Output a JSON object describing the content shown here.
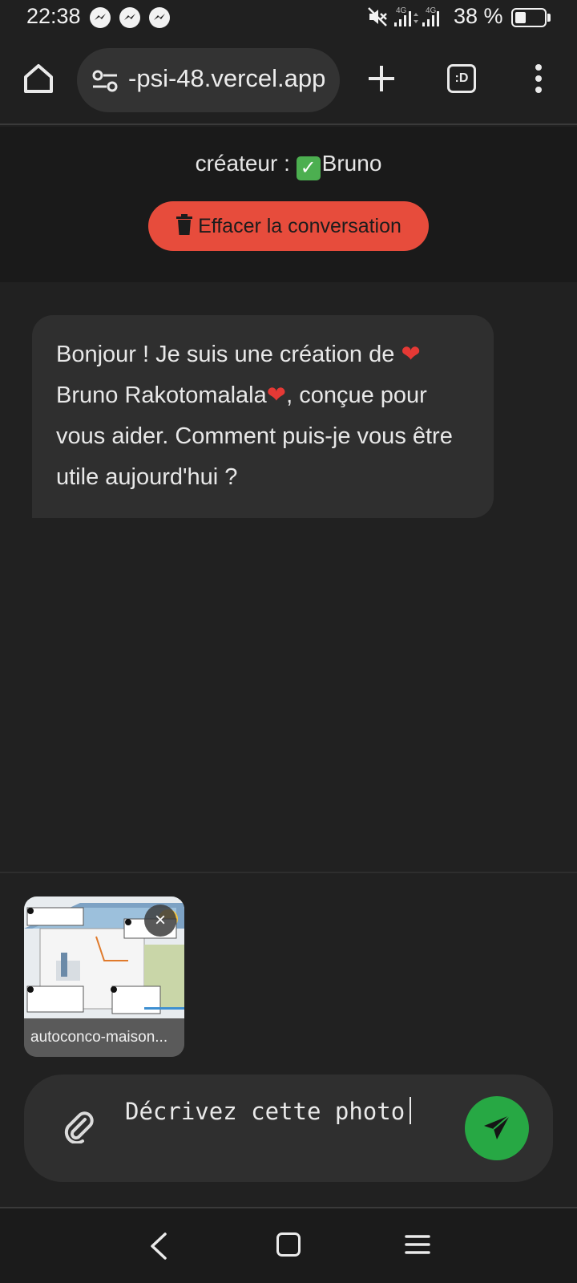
{
  "status_bar": {
    "time": "22:38",
    "network_label_1": "4G",
    "network_label_2": "4G",
    "battery": "38 %",
    "battery_level_fraction": 0.38,
    "notification_icons": [
      "messenger-icon",
      "messenger-icon",
      "messenger-icon"
    ],
    "system_icons": [
      "mute-icon",
      "signal-icon",
      "signal-icon",
      "battery-icon"
    ]
  },
  "browser": {
    "url": "-psi-48.vercel.app",
    "tab_switcher_label": ":D",
    "icons": [
      "home-icon",
      "site-settings-icon",
      "plus-icon",
      "tab-switcher-icon",
      "more-vert-icon"
    ]
  },
  "header": {
    "creator_prefix": "créateur : ",
    "check_emoji": "✓",
    "creator_name": "Bruno",
    "clear_button_label": "Effacer la conversation"
  },
  "messages": [
    {
      "role": "bot",
      "text_1": "Bonjour ! Je suis une création de ",
      "heart": "❤",
      "text_2": "Bruno Rakotomalala",
      "text_3": ", conçue pour vous aider. Comment puis-je vous être utile aujourd'hui ?"
    }
  ],
  "attachment": {
    "filename": "autoconco-maison...",
    "remove_label": "×"
  },
  "composer": {
    "input_value": "Décrivez cette photo",
    "icons": [
      "paperclip-icon",
      "send-icon"
    ]
  },
  "colors": {
    "background": "#212121",
    "header_background": "#1a1a1a",
    "bubble": "#2f2f2f",
    "clear_button": "#e74c3c",
    "send_button": "#27a844"
  }
}
